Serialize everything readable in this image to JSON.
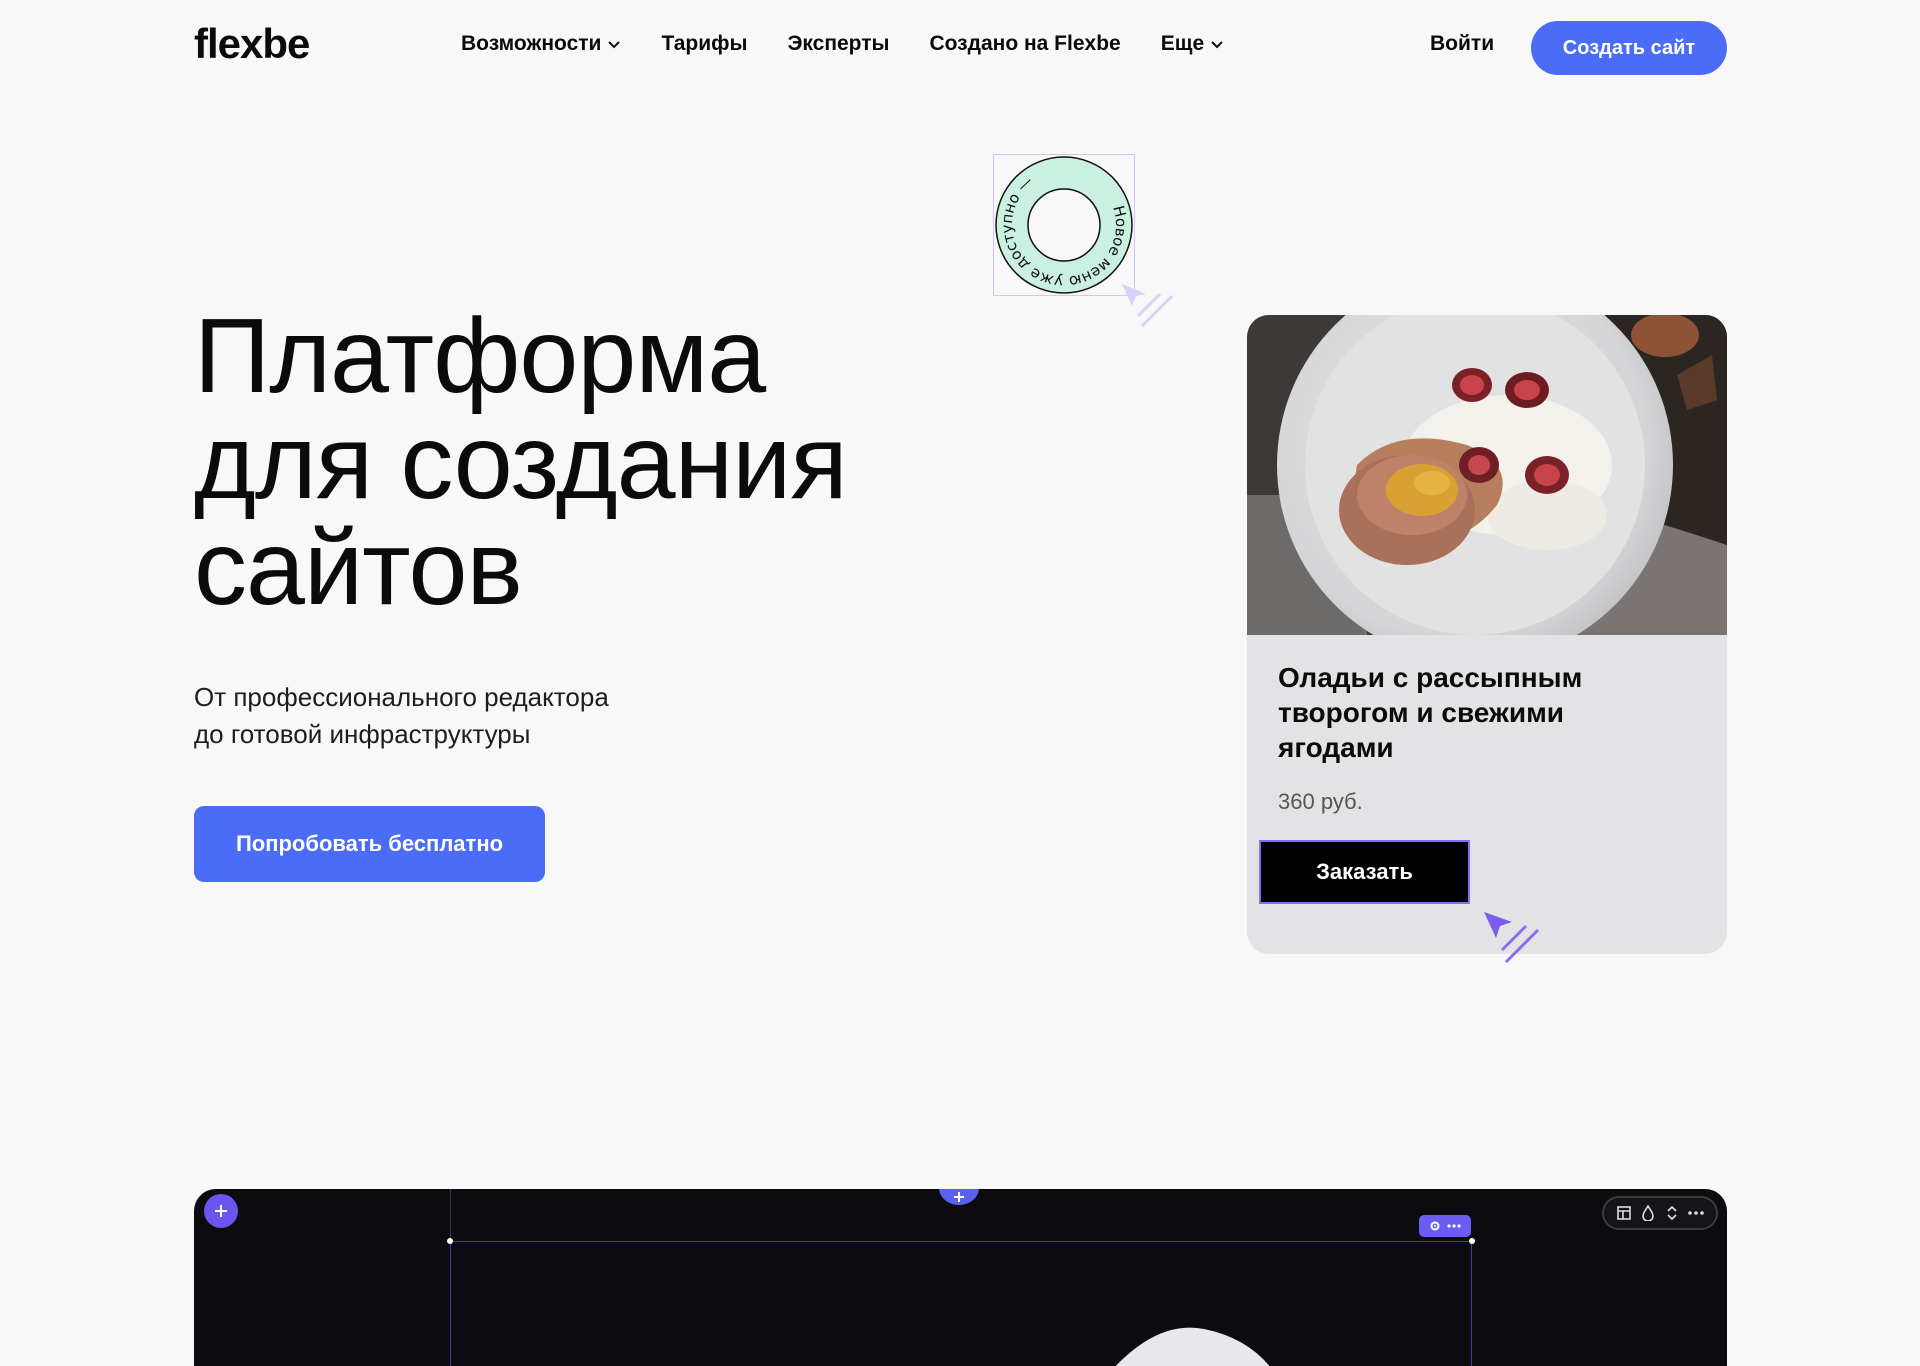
{
  "header": {
    "logo": "flexbe",
    "nav": [
      {
        "label": "Возможности",
        "has_dropdown": true
      },
      {
        "label": "Тарифы",
        "has_dropdown": false
      },
      {
        "label": "Эксперты",
        "has_dropdown": false
      },
      {
        "label": "Создано на Flexbe",
        "has_dropdown": false
      },
      {
        "label": "Еще",
        "has_dropdown": true
      }
    ],
    "login": "Войти",
    "create_site": "Создать сайт"
  },
  "hero": {
    "title_lines": [
      "Платформа",
      "для создания",
      "сайтов"
    ],
    "subtitle_lines": [
      "От профессионального редактора",
      "до готовой инфраструктуры"
    ],
    "cta": "Попробовать бесплатно"
  },
  "badge": {
    "circular_text": "Новое меню уже доступно —"
  },
  "product_card": {
    "title_lines": [
      "Оладьи с рассыпным",
      "творогом и свежими",
      "ягодами"
    ],
    "price": "360 руб.",
    "order_button": "Заказать"
  },
  "editor_preview": {
    "add_icon": "plus-icon",
    "block_tools": [
      "gear-icon",
      "more-icon"
    ],
    "toolbar_icons": [
      "layout-icon",
      "drop-icon",
      "reorder-icon",
      "more-icon"
    ]
  },
  "colors": {
    "accent": "#4a6cf7",
    "editor_accent": "#6a55f0",
    "badge_fill": "#c9f0e1",
    "cursor": "#7c5cf0"
  }
}
